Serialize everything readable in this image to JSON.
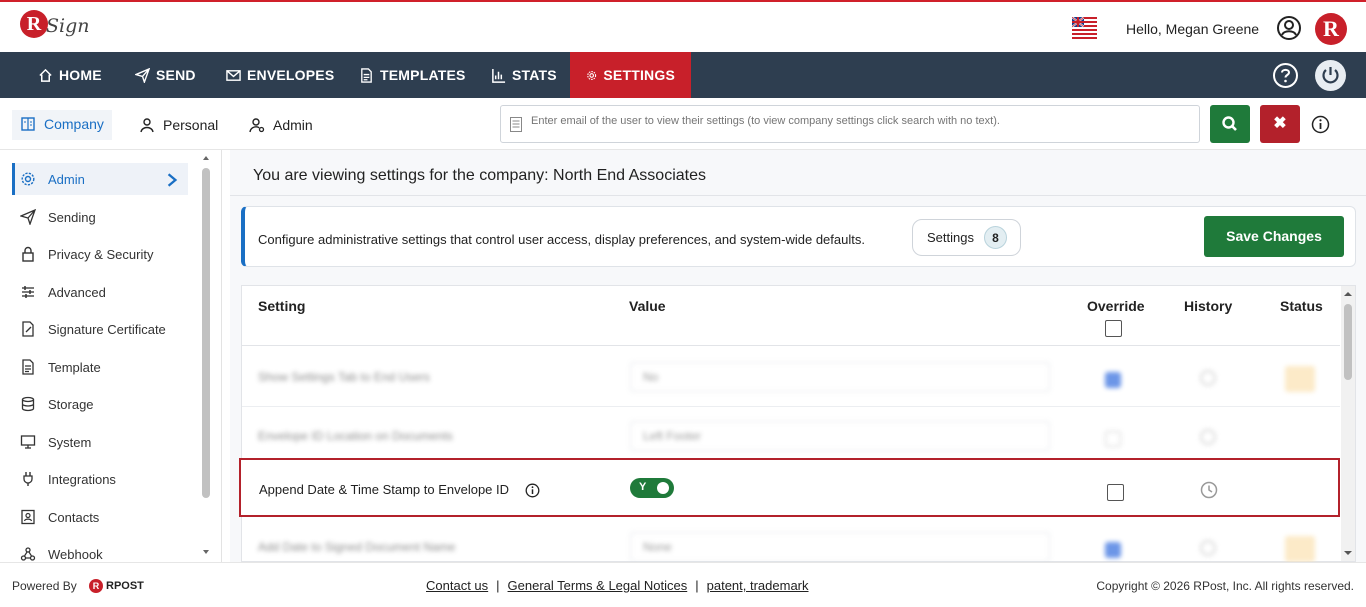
{
  "header": {
    "logo_text": "Sign",
    "greeting": "Hello, Megan Greene",
    "brand_letter": "R",
    "flag": "uk-flag-icon"
  },
  "nav": {
    "items": [
      {
        "label": "HOME",
        "icon": "home-icon"
      },
      {
        "label": "SEND",
        "icon": "send-icon"
      },
      {
        "label": "ENVELOPES",
        "icon": "envelope-icon"
      },
      {
        "label": "TEMPLATES",
        "icon": "document-icon"
      },
      {
        "label": "STATS",
        "icon": "bar-chart-icon"
      },
      {
        "label": "SETTINGS",
        "icon": "gear-icon"
      }
    ],
    "active": "SETTINGS",
    "accent": "#c8202a",
    "bg": "#2e3e50"
  },
  "subbar": {
    "tabs": [
      {
        "label": "Company",
        "active": true
      },
      {
        "label": "Personal",
        "active": false
      },
      {
        "label": "Admin",
        "active": false
      }
    ],
    "search_placeholder": "Enter email of the user to view their settings (to view company settings click search with no text)."
  },
  "sidebar": {
    "items": [
      {
        "label": "Admin",
        "icon": "gear-icon",
        "active": true
      },
      {
        "label": "Sending",
        "icon": "send-icon"
      },
      {
        "label": "Privacy & Security",
        "icon": "lock-icon"
      },
      {
        "label": "Advanced",
        "icon": "sliders-icon"
      },
      {
        "label": "Signature Certificate",
        "icon": "certificate-icon"
      },
      {
        "label": "Template",
        "icon": "template-icon"
      },
      {
        "label": "Storage",
        "icon": "database-icon"
      },
      {
        "label": "System",
        "icon": "monitor-icon"
      },
      {
        "label": "Integrations",
        "icon": "plug-icon"
      },
      {
        "label": "Contacts",
        "icon": "contacts-icon"
      },
      {
        "label": "Webhook",
        "icon": "webhook-icon"
      }
    ]
  },
  "content": {
    "heading": "You are viewing settings for the company: North End Associates",
    "info_text": "Configure administrative settings that control user access, display preferences, and system-wide defaults.",
    "settings_label": "Settings",
    "settings_count": "8",
    "save_label": "Save Changes",
    "table": {
      "columns": [
        "Setting",
        "Value",
        "Override",
        "History",
        "Status"
      ],
      "blurred_rows": [
        {
          "name": "Show Settings Tab to End Users",
          "value": "No"
        },
        {
          "name": "Envelope ID Location on Documents",
          "value": "Left Footer"
        },
        {
          "name": "Add Date to Signed Document Name",
          "value": "None"
        }
      ],
      "highlighted_row": {
        "name": "Append Date & Time Stamp to Envelope ID",
        "toggle_label": "Y",
        "toggle_on": true
      }
    }
  },
  "footer": {
    "powered_by": "Powered By",
    "rpost": "RPOST",
    "links": [
      "Contact us",
      "General Terms & Legal Notices",
      "patent, trademark"
    ],
    "separator": "|",
    "copyright": "Copyright © 2026 RPost, Inc. All rights reserved."
  }
}
